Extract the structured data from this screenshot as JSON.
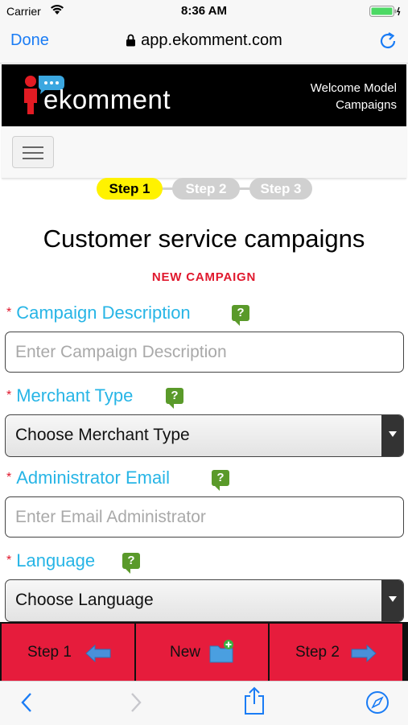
{
  "status": {
    "carrier": "Carrier",
    "time": "8:36 AM"
  },
  "browser": {
    "done_label": "Done",
    "url": "app.ekomment.com"
  },
  "header": {
    "brand": "ekomment",
    "welcome_line1": "Welcome Model",
    "welcome_line2": "Campaigns"
  },
  "steps": [
    {
      "label": "Step 1",
      "active": true
    },
    {
      "label": "Step 2",
      "active": false
    },
    {
      "label": "Step 3",
      "active": false
    }
  ],
  "page": {
    "title": "Customer service campaigns",
    "subtitle": "NEW CAMPAIGN"
  },
  "form": {
    "required_mark": "*",
    "help_mark": "?",
    "campaign_description": {
      "label": "Campaign Description",
      "placeholder": "Enter Campaign Description"
    },
    "merchant_type": {
      "label": "Merchant Type",
      "value": "Choose Merchant Type"
    },
    "admin_email": {
      "label": "Administrator Email",
      "placeholder": "Enter Email Administrator"
    },
    "language": {
      "label": "Language",
      "value": "Choose Language"
    }
  },
  "actions": {
    "step1_label": "Step 1",
    "new_label": "New",
    "step2_label": "Step 2"
  },
  "colors": {
    "accent_blue": "#27b5e6",
    "required_red": "#e0182d",
    "action_red": "#e61c3c",
    "step_active": "#fff200",
    "ios_blue": "#1a7cf5"
  },
  "icons": [
    "wifi-icon",
    "battery-icon",
    "lock-icon",
    "reload-icon",
    "logo-person-icon",
    "hamburger-icon",
    "help-icon",
    "arrow-left-icon",
    "folder-add-icon",
    "arrow-right-icon",
    "back-icon",
    "forward-icon",
    "share-icon",
    "compass-icon"
  ]
}
